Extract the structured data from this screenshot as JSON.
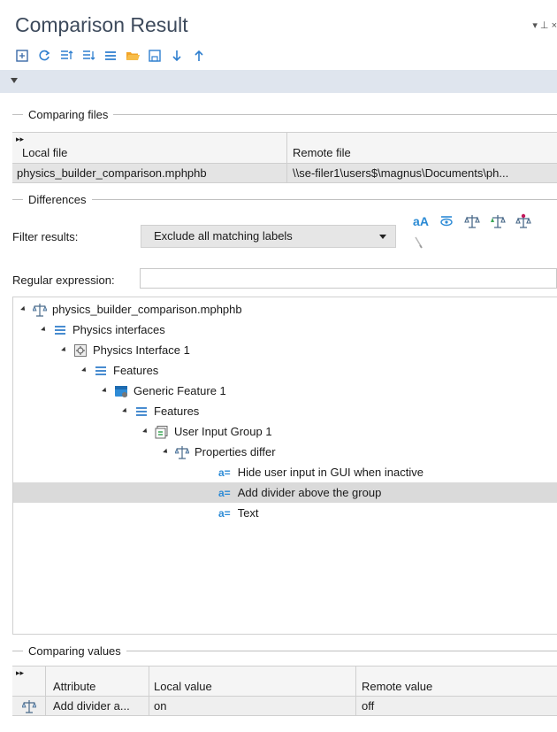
{
  "panel": {
    "title": "Comparison Result",
    "pin_controls": "▾ ⊥ ×"
  },
  "toolbar": {
    "buttons": [
      {
        "icon": "save-comparison-icon"
      },
      {
        "icon": "refresh-icon"
      },
      {
        "icon": "expand-all-icon"
      },
      {
        "icon": "collapse-all-icon"
      },
      {
        "icon": "list-icon"
      },
      {
        "icon": "open-folder-icon"
      },
      {
        "icon": "save-icon"
      },
      {
        "icon": "next-difference-icon"
      },
      {
        "icon": "previous-difference-icon"
      }
    ]
  },
  "comparing_files": {
    "header": "Comparing files",
    "columns": [
      "Local file",
      "Remote file"
    ],
    "expand_glyph": "▸▸",
    "row": {
      "local": "physics_builder_comparison.mphphb",
      "remote": "\\\\se-filer1\\users$\\magnus\\Documents\\ph..."
    }
  },
  "differences": {
    "header": "Differences",
    "filter_label": "Filter results:",
    "filter_value": "Exclude all matching labels",
    "filter_icons": [
      "match-case-icon",
      "filter-visible-icon",
      "differences-icon",
      "left-differences-icon",
      "right-differences-icon"
    ],
    "match_case_text": "aA",
    "regex_label": "Regular expression:",
    "regex_value": ""
  },
  "tree": [
    {
      "label": "physics_builder_comparison.mphphb",
      "icon": "scale-icon",
      "level": 0,
      "expanded": true
    },
    {
      "label": "Physics interfaces",
      "icon": "list-icon",
      "level": 1,
      "expanded": true
    },
    {
      "label": "Physics Interface 1",
      "icon": "physics-interface-icon",
      "level": 2,
      "expanded": true
    },
    {
      "label": "Features",
      "icon": "list-icon",
      "level": 3,
      "expanded": true
    },
    {
      "label": "Generic Feature 1",
      "icon": "feature-icon",
      "level": 4,
      "expanded": true
    },
    {
      "label": "Features",
      "icon": "list-icon",
      "level": 5,
      "expanded": true
    },
    {
      "label": "User Input Group 1",
      "icon": "input-group-icon",
      "level": 6,
      "expanded": true
    },
    {
      "label": "Properties differ",
      "icon": "scale-icon",
      "level": 7,
      "expanded": true
    },
    {
      "label": "Hide user input in GUI when inactive",
      "icon": "attribute-icon",
      "level": 8
    },
    {
      "label": "Add divider above the group",
      "icon": "attribute-icon",
      "level": 8,
      "selected": true
    },
    {
      "label": "Text",
      "icon": "attribute-icon",
      "level": 8
    }
  ],
  "attribute_glyph": "a=",
  "comparing_values": {
    "header": "Comparing values",
    "expand_glyph": "▸▸",
    "columns": [
      "Attribute",
      "Local value",
      "Remote value"
    ],
    "row": {
      "icon": "scale-icon",
      "attribute": "Add divider a...",
      "local": "on",
      "remote": "off"
    }
  },
  "colors": {
    "accent_blue": "#2e8bd6",
    "title": "#3d4a5c",
    "selection": "#dadada",
    "collapse_bar": "#dfe5ee"
  }
}
